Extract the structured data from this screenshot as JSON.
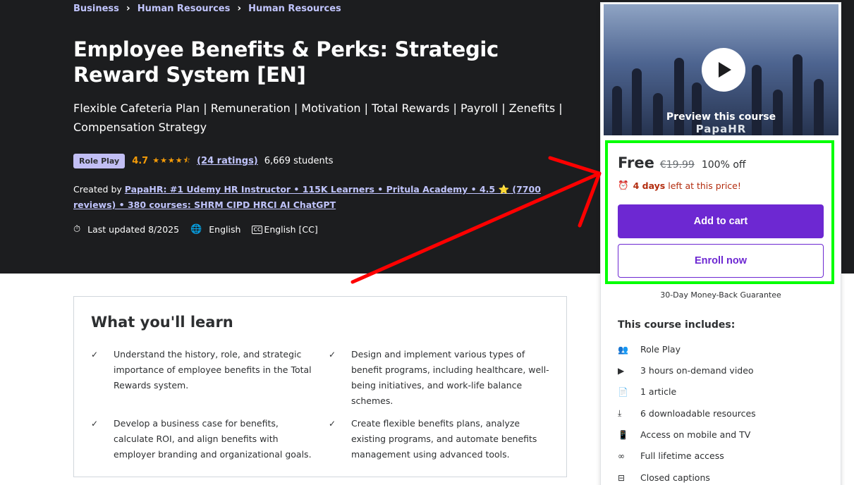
{
  "breadcrumb": [
    "Business",
    "Human Resources",
    "Human Resources"
  ],
  "course": {
    "title": "Employee Benefits & Perks: Strategic Reward System [EN]",
    "subtitle": "Flexible Cafeteria Plan | Remuneration | Motivation | Total Rewards | Payroll | Zenefits | Compensation Strategy",
    "badge": "Role Play",
    "rating": "4.7",
    "stars": "★★★★⯪",
    "ratings_count": "(24 ratings)",
    "students": "6,669 students",
    "created_prefix": "Created by",
    "instructor": "PapaHR: #1 Udemy HR Instructor • 115K Learners • Pritula Academy • 4.5 ⭐ (7700 reviews) • 380 courses: SHRM CIPD HRCI AI ChatGPT",
    "updated": "Last updated 8/2025",
    "language": "English",
    "captions": "English [CC]"
  },
  "learn": {
    "title": "What you'll learn",
    "items": [
      "Understand the history, role, and strategic importance of employee benefits in the Total Rewards system.",
      "Design and implement various types of benefit programs, including healthcare, well-being initiatives, and work-life balance schemes.",
      "Develop a business case for benefits, calculate ROI, and align benefits with employer branding and organizational goals.",
      "Create flexible benefits plans, analyze existing programs, and automate benefits management using advanced tools."
    ]
  },
  "sidebar": {
    "preview_label": "Preview this course",
    "watermark": "PapaHR",
    "price": "Free",
    "old_price": "€19.99",
    "discount": "100% off",
    "timer_days": "4 days",
    "timer_text": "left at this price!",
    "add_to_cart": "Add to cart",
    "enroll_now": "Enroll now",
    "guarantee": "30-Day Money-Back Guarantee",
    "includes_title": "This course includes:",
    "includes": [
      {
        "icon": "role-play-icon",
        "label": "Role Play"
      },
      {
        "icon": "video-icon",
        "label": "3 hours on-demand video"
      },
      {
        "icon": "article-icon",
        "label": "1 article"
      },
      {
        "icon": "download-icon",
        "label": "6 downloadable resources"
      },
      {
        "icon": "mobile-icon",
        "label": "Access on mobile and TV"
      },
      {
        "icon": "infinity-icon",
        "label": "Full lifetime access"
      },
      {
        "icon": "captions-icon",
        "label": "Closed captions"
      }
    ]
  },
  "colors": {
    "hero_bg": "#1c1d1f",
    "accent": "#6d28d2",
    "link": "#c0c4fc",
    "star": "#f69c08",
    "timer": "#b32d0f",
    "highlight": "#00ff00",
    "arrow": "#ff0000"
  }
}
